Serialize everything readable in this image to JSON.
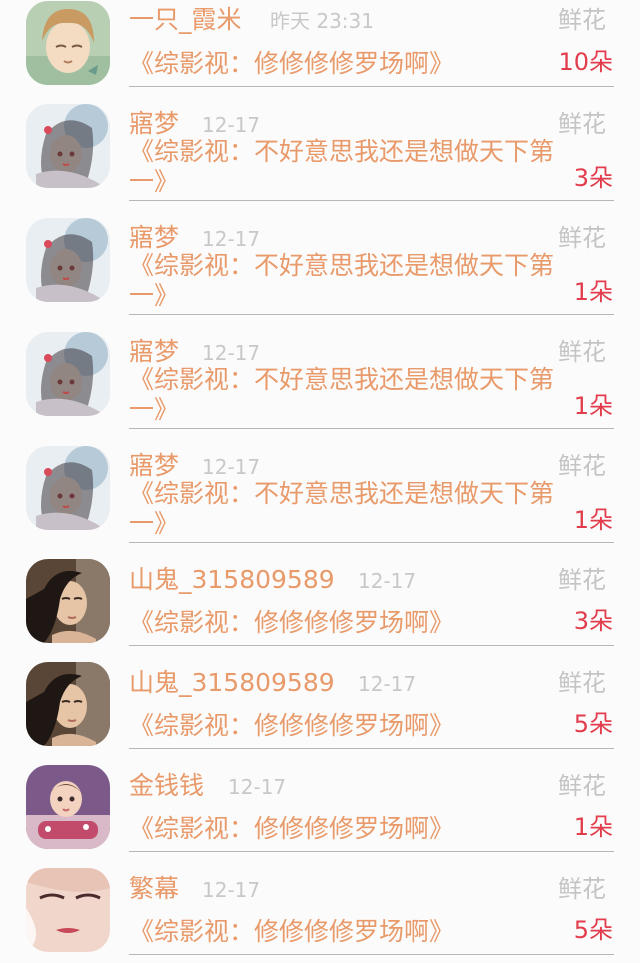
{
  "gift_label": "鲜花",
  "rows": [
    {
      "name": "一只_霞米",
      "time": "昨天 23:31",
      "book": "《综影视：修修修修罗场啊》",
      "count": "10朵",
      "avatar": "anime-boy-avatar"
    },
    {
      "name": "寤梦",
      "time": "12-17",
      "book": "《综影视：不好意思我还是想做天下第一》",
      "count": "3朵",
      "avatar": "anime-girl-avatar"
    },
    {
      "name": "寤梦",
      "time": "12-17",
      "book": "《综影视：不好意思我还是想做天下第一》",
      "count": "1朵",
      "avatar": "anime-girl-avatar"
    },
    {
      "name": "寤梦",
      "time": "12-17",
      "book": "《综影视：不好意思我还是想做天下第一》",
      "count": "1朵",
      "avatar": "anime-girl-avatar"
    },
    {
      "name": "寤梦",
      "time": "12-17",
      "book": "《综影视：不好意思我还是想做天下第一》",
      "count": "1朵",
      "avatar": "anime-girl-avatar"
    },
    {
      "name": "山鬼_315809589",
      "time": "12-17",
      "book": "《综影视：修修修修罗场啊》",
      "count": "3朵",
      "avatar": "woman-portrait-avatar"
    },
    {
      "name": "山鬼_315809589",
      "time": "12-17",
      "book": "《综影视：修修修修罗场啊》",
      "count": "5朵",
      "avatar": "woman-portrait-avatar"
    },
    {
      "name": "金钱钱",
      "time": "12-17",
      "book": "《综影视：修修修修罗场啊》",
      "count": "1朵",
      "avatar": "baby-photo-avatar"
    },
    {
      "name": "繁幕",
      "time": "12-17",
      "book": "《综影视：修修修修罗场啊》",
      "count": "5朵",
      "avatar": "face-closeup-avatar"
    }
  ]
}
